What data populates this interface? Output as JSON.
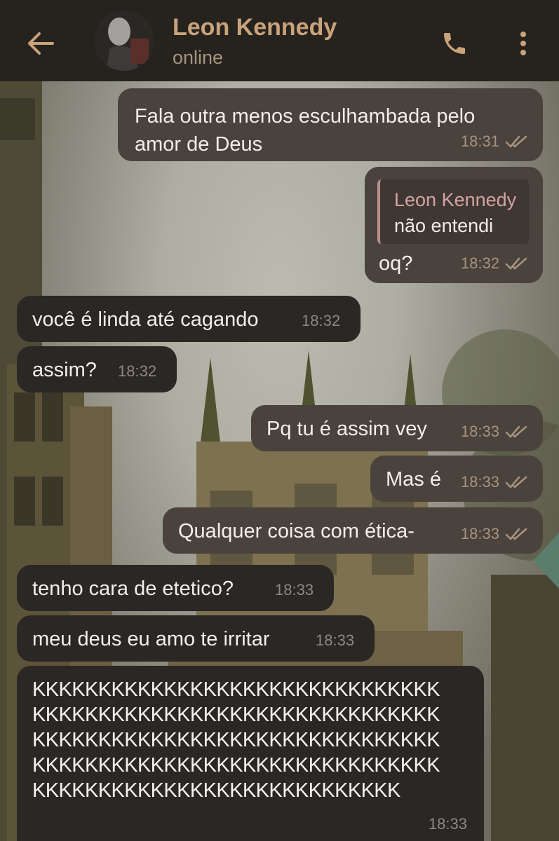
{
  "header": {
    "contact_name": "Leon Kennedy",
    "status": "online"
  },
  "messages": [
    {
      "direction": "out",
      "text_line1": "Fala outra menos esculhambada pelo",
      "text_line2": "amor de Deus",
      "time": "18:31",
      "read": true
    },
    {
      "direction": "out",
      "reply_to": {
        "name": "Leon Kennedy",
        "text": "não entendi"
      },
      "text": "oq?",
      "time": "18:32",
      "read": true
    },
    {
      "direction": "in",
      "text": "você é linda até cagando",
      "time": "18:32"
    },
    {
      "direction": "in",
      "text": "assim?",
      "time": "18:32"
    },
    {
      "direction": "out",
      "text": "Pq tu é assim vey",
      "time": "18:33",
      "read": true
    },
    {
      "direction": "out",
      "text": "Mas é",
      "time": "18:33",
      "read": true
    },
    {
      "direction": "out",
      "text": "Qualquer coisa com ética-",
      "time": "18:33",
      "read": true
    },
    {
      "direction": "in",
      "text": "tenho cara de etetico?",
      "time": "18:33"
    },
    {
      "direction": "in",
      "text": "meu deus eu amo te irritar",
      "time": "18:33"
    },
    {
      "direction": "in",
      "lines": [
        "KKKKKKKKKKKKKKKKKKKKKKKKKKKKKKK",
        "KKKKKKKKKKKKKKKKKKKKKKKKKKKKKKK",
        "KKKKKKKKKKKKKKKKKKKKKKKKKKKKKKK",
        "KKKKKKKKKKKKKKKKKKKKKKKKKKKKKKK",
        "KKKKKKKKKKKKKKKKKKKKKKKKKKKK"
      ],
      "time": "18:33"
    }
  ],
  "colors": {
    "header_bg": "#26231f",
    "accent": "#c9a37a",
    "outgoing_bubble": "#4a423c",
    "incoming_bubble": "#2a2725"
  },
  "icons": [
    "back-arrow-icon",
    "avatar",
    "phone-icon",
    "more-vertical-icon",
    "double-check-icon"
  ]
}
